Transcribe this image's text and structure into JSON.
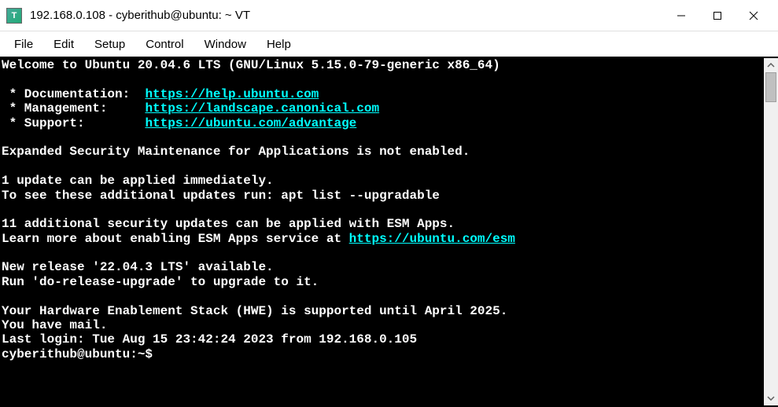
{
  "window": {
    "title": "192.168.0.108 - cyberithub@ubuntu: ~ VT",
    "icon_letter": "T"
  },
  "menu": {
    "file": "File",
    "edit": "Edit",
    "setup": "Setup",
    "control": "Control",
    "window": "Window",
    "help": "Help"
  },
  "terminal": {
    "line1": "Welcome to Ubuntu 20.04.6 LTS (GNU/Linux 5.15.0-79-generic x86_64)",
    "doc_label": " * Documentation:  ",
    "doc_url": "https://help.ubuntu.com",
    "mgmt_label": " * Management:     ",
    "mgmt_url": "https://landscape.canonical.com",
    "support_label": " * Support:        ",
    "support_url": "https://ubuntu.com/advantage",
    "esm_line": "Expanded Security Maintenance for Applications is not enabled.",
    "update_line1": "1 update can be applied immediately.",
    "update_line2": "To see these additional updates run: apt list --upgradable",
    "esm_line2": "11 additional security updates can be applied with ESM Apps.",
    "esm_line3a": "Learn more about enabling ESM Apps service at ",
    "esm_line3b": "https://ubuntu.com/esm",
    "release_line1": "New release '22.04.3 LTS' available.",
    "release_line2": "Run 'do-release-upgrade' to upgrade to it.",
    "hwe_line": "Your Hardware Enablement Stack (HWE) is supported until April 2025.",
    "mail_line": "You have mail.",
    "login_line": "Last login: Tue Aug 15 23:42:24 2023 from 192.168.0.105",
    "prompt": "cyberithub@ubuntu:~$"
  }
}
